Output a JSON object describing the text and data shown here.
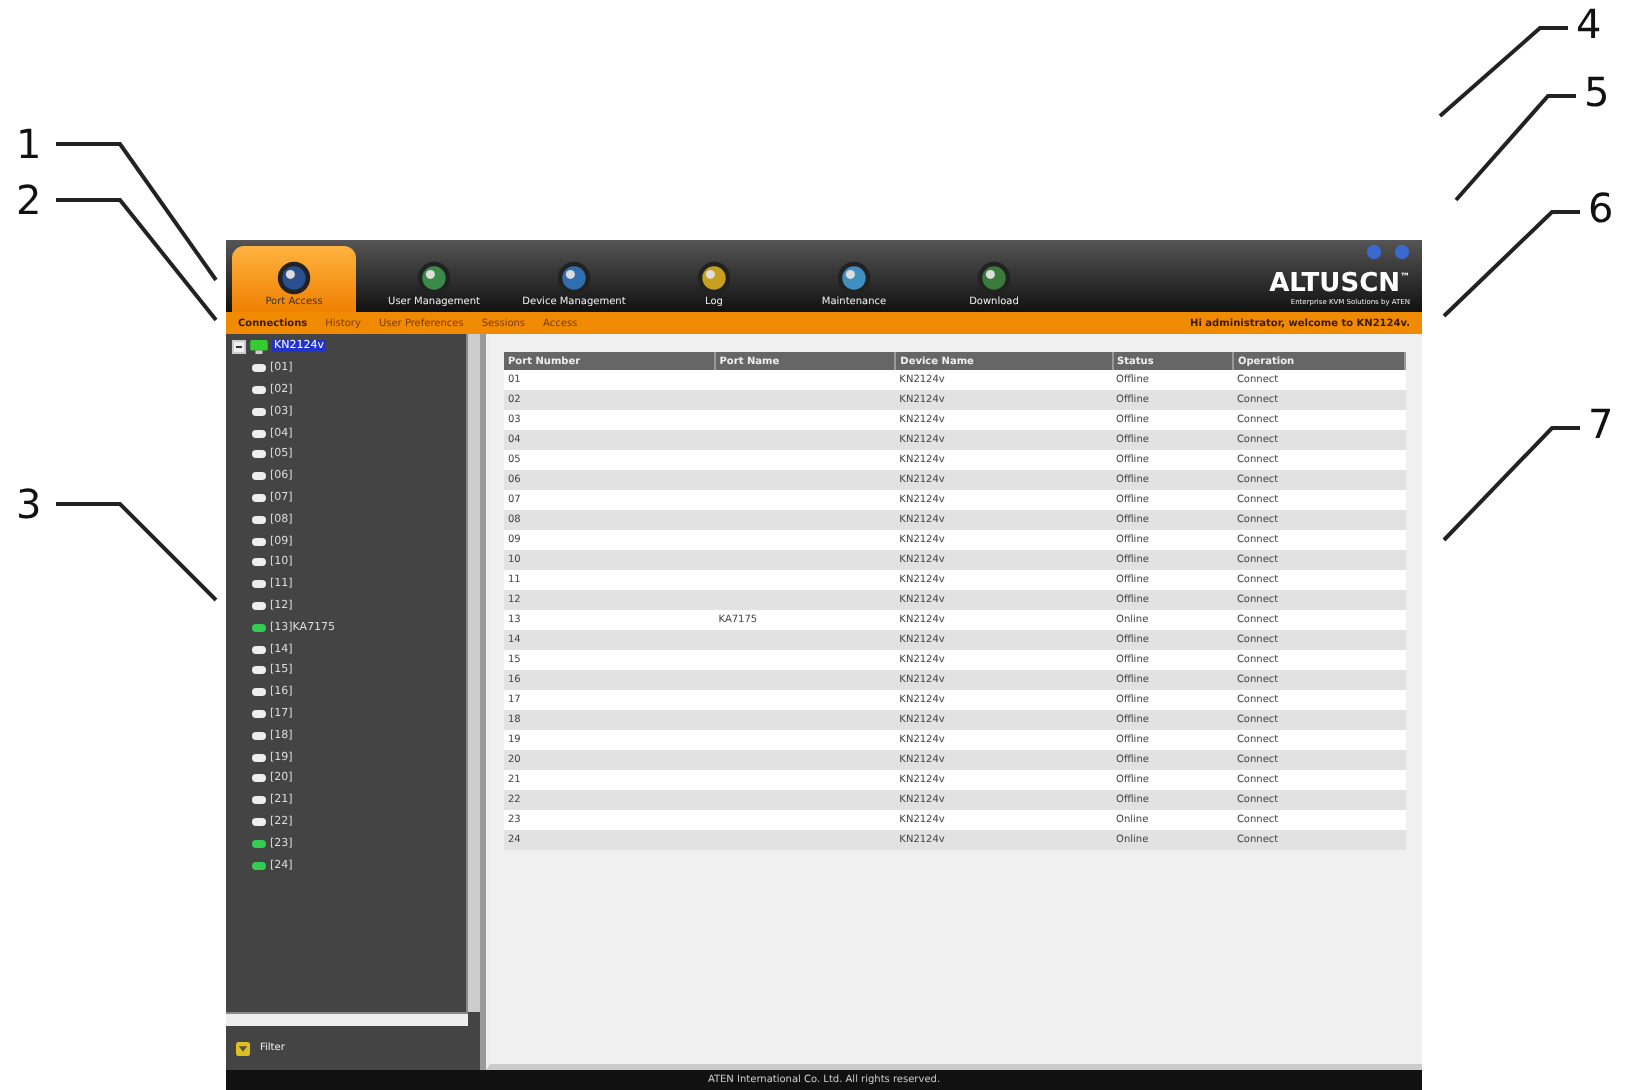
{
  "callouts": [
    "1",
    "2",
    "3",
    "4",
    "5",
    "6",
    "7"
  ],
  "nav_tabs": [
    {
      "label": "Port Access",
      "selected": true
    },
    {
      "label": "User Management",
      "selected": false
    },
    {
      "label": "Device Management",
      "selected": false
    },
    {
      "label": "Log",
      "selected": false
    },
    {
      "label": "Maintenance",
      "selected": false
    },
    {
      "label": "Download",
      "selected": false
    }
  ],
  "logo": {
    "name": "ALTUSCN",
    "mark": "™",
    "tagline": "Enterprise KVM Solutions by ATEN"
  },
  "sub_tabs": [
    {
      "label": "Connections",
      "selected": true
    },
    {
      "label": "History",
      "selected": false
    },
    {
      "label": "User Preferences",
      "selected": false
    },
    {
      "label": "Sessions",
      "selected": false
    },
    {
      "label": "Access",
      "selected": false
    }
  ],
  "welcome": "Hi administrator, welcome to KN2124v.",
  "tree": {
    "label": "KN2124v",
    "expanded": true,
    "selected": true,
    "children": [
      {
        "label": "[01]",
        "online": false
      },
      {
        "label": "[02]",
        "online": false
      },
      {
        "label": "[03]",
        "online": false
      },
      {
        "label": "[04]",
        "online": false
      },
      {
        "label": "[05]",
        "online": false
      },
      {
        "label": "[06]",
        "online": false
      },
      {
        "label": "[07]",
        "online": false
      },
      {
        "label": "[08]",
        "online": false
      },
      {
        "label": "[09]",
        "online": false
      },
      {
        "label": "[10]",
        "online": false
      },
      {
        "label": "[11]",
        "online": false
      },
      {
        "label": "[12]",
        "online": false
      },
      {
        "label": "[13]KA7175",
        "online": true
      },
      {
        "label": "[14]",
        "online": false
      },
      {
        "label": "[15]",
        "online": false
      },
      {
        "label": "[16]",
        "online": false
      },
      {
        "label": "[17]",
        "online": false
      },
      {
        "label": "[18]",
        "online": false
      },
      {
        "label": "[19]",
        "online": false
      },
      {
        "label": "[20]",
        "online": false
      },
      {
        "label": "[21]",
        "online": false
      },
      {
        "label": "[22]",
        "online": false
      },
      {
        "label": "[23]",
        "online": true
      },
      {
        "label": "[24]",
        "online": true
      }
    ]
  },
  "filter": "Filter",
  "table": {
    "columns": [
      "Port Number",
      "Port Name",
      "Device Name",
      "Status",
      "Operation"
    ],
    "rows": [
      [
        "01",
        "",
        "KN2124v",
        "Offline",
        "Connect"
      ],
      [
        "02",
        "",
        "KN2124v",
        "Offline",
        "Connect"
      ],
      [
        "03",
        "",
        "KN2124v",
        "Offline",
        "Connect"
      ],
      [
        "04",
        "",
        "KN2124v",
        "Offline",
        "Connect"
      ],
      [
        "05",
        "",
        "KN2124v",
        "Offline",
        "Connect"
      ],
      [
        "06",
        "",
        "KN2124v",
        "Offline",
        "Connect"
      ],
      [
        "07",
        "",
        "KN2124v",
        "Offline",
        "Connect"
      ],
      [
        "08",
        "",
        "KN2124v",
        "Offline",
        "Connect"
      ],
      [
        "09",
        "",
        "KN2124v",
        "Offline",
        "Connect"
      ],
      [
        "10",
        "",
        "KN2124v",
        "Offline",
        "Connect"
      ],
      [
        "11",
        "",
        "KN2124v",
        "Offline",
        "Connect"
      ],
      [
        "12",
        "",
        "KN2124v",
        "Offline",
        "Connect"
      ],
      [
        "13",
        "KA7175",
        "KN2124v",
        "Online",
        "Connect"
      ],
      [
        "14",
        "",
        "KN2124v",
        "Offline",
        "Connect"
      ],
      [
        "15",
        "",
        "KN2124v",
        "Offline",
        "Connect"
      ],
      [
        "16",
        "",
        "KN2124v",
        "Offline",
        "Connect"
      ],
      [
        "17",
        "",
        "KN2124v",
        "Offline",
        "Connect"
      ],
      [
        "18",
        "",
        "KN2124v",
        "Offline",
        "Connect"
      ],
      [
        "19",
        "",
        "KN2124v",
        "Offline",
        "Connect"
      ],
      [
        "20",
        "",
        "KN2124v",
        "Offline",
        "Connect"
      ],
      [
        "21",
        "",
        "KN2124v",
        "Offline",
        "Connect"
      ],
      [
        "22",
        "",
        "KN2124v",
        "Offline",
        "Connect"
      ],
      [
        "23",
        "",
        "KN2124v",
        "Online",
        "Connect"
      ],
      [
        "24",
        "",
        "KN2124v",
        "Online",
        "Connect"
      ]
    ]
  },
  "footer": "ATEN International Co. Ltd. All rights reserved."
}
